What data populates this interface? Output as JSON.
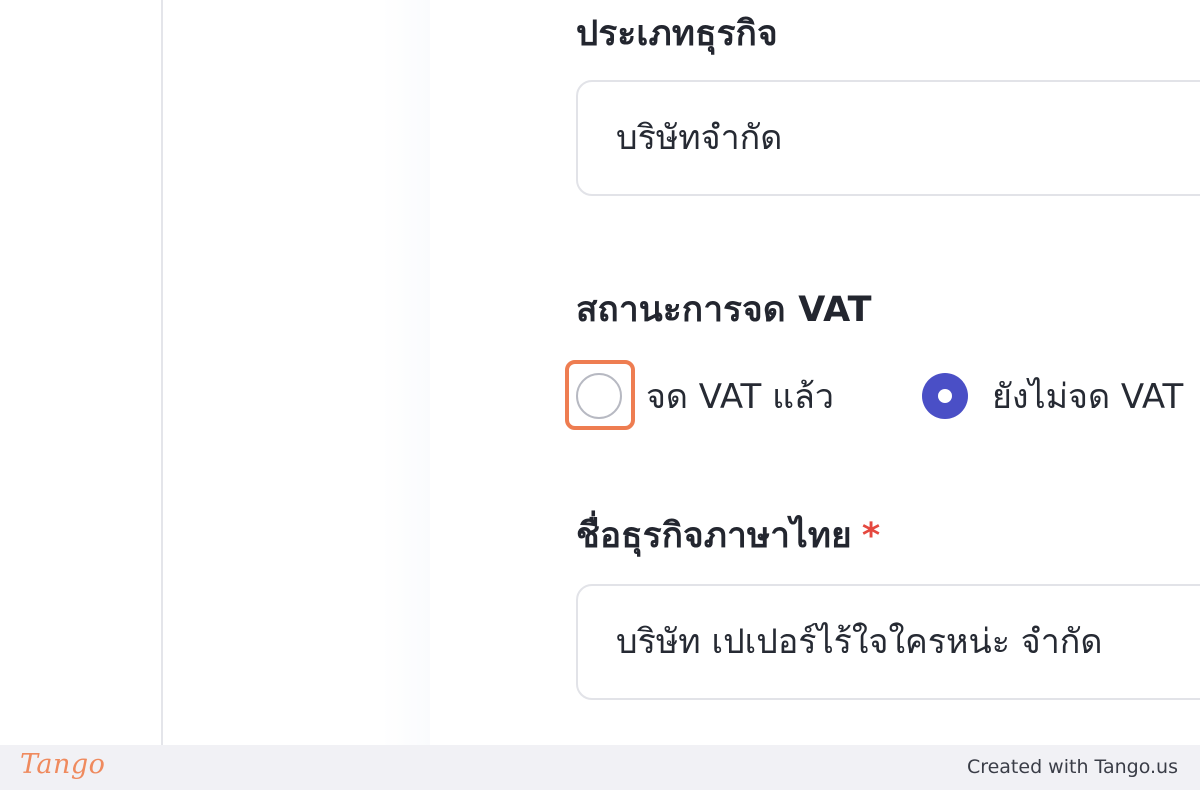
{
  "form": {
    "business_type": {
      "label": "ประเภทธุรกิจ",
      "value": "บริษัทจำกัด"
    },
    "vat_status": {
      "label": "สถานะการจด VAT",
      "options": [
        {
          "label": "จด VAT แล้ว",
          "selected": false
        },
        {
          "label": "ยังไม่จด VAT",
          "selected": true
        }
      ]
    },
    "business_name_th": {
      "label": "ชื่อธุรกิจภาษาไทย",
      "required_mark": "*",
      "value": "บริษัท เปเปอร์ไร้ใจใครหน่ะ จำกัด"
    }
  },
  "colors": {
    "radio_checked": "#4a4fc6",
    "highlight": "#ee7d51",
    "required": "#e5483f"
  },
  "footer": {
    "logo": "Tango",
    "credit": "Created with Tango.us"
  }
}
